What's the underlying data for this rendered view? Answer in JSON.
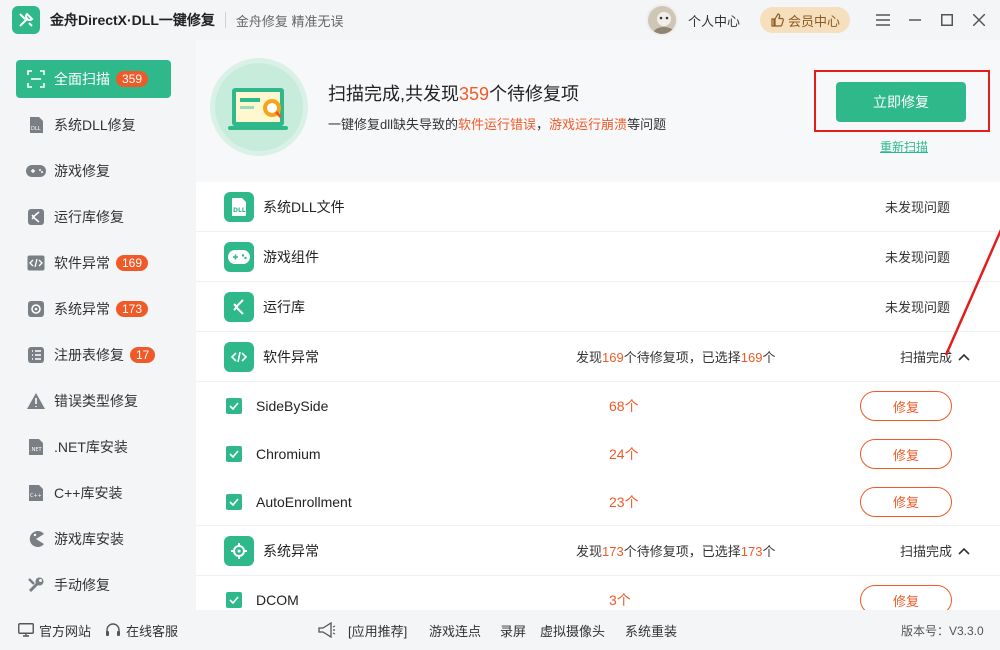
{
  "app": {
    "title": "金舟DirectX·DLL一键修复",
    "slogan": "金舟修复 精准无误",
    "user_center": "个人中心",
    "vip_label": "会员中心"
  },
  "sidebar": {
    "items": [
      {
        "label": "全面扫描",
        "badge": "359",
        "icon": "scan-icon",
        "active": true
      },
      {
        "label": "系统DLL修复",
        "badge": "",
        "icon": "dll-icon"
      },
      {
        "label": "游戏修复",
        "badge": "",
        "icon": "gamepad-icon"
      },
      {
        "label": "运行库修复",
        "badge": "",
        "icon": "vs-icon"
      },
      {
        "label": "软件异常",
        "badge": "169",
        "icon": "code-icon"
      },
      {
        "label": "系统异常",
        "badge": "173",
        "icon": "gear-icon"
      },
      {
        "label": "注册表修复",
        "badge": "17",
        "icon": "list-icon"
      },
      {
        "label": "错误类型修复",
        "badge": "",
        "icon": "warning-icon"
      },
      {
        "label": ".NET库安装",
        "badge": "",
        "icon": "net-icon"
      },
      {
        "label": "C++库安装",
        "badge": "",
        "icon": "cpp-icon"
      },
      {
        "label": "游戏库安装",
        "badge": "",
        "icon": "pacman-icon"
      },
      {
        "label": "手动修复",
        "badge": "",
        "icon": "wrench-icon"
      }
    ]
  },
  "hero": {
    "title_prefix": "扫描完成,共发现",
    "count": "359",
    "title_suffix": "个待修复项",
    "sub_prefix": "一键修复dll缺失导致的",
    "sub_hl1": "软件运行错误",
    "sub_sep": "，",
    "sub_hl2": "游戏运行崩溃",
    "sub_suffix": "等问题",
    "fix_now": "立即修复",
    "rescan": "重新扫描"
  },
  "categories": {
    "dll": {
      "name": "系统DLL文件",
      "status": "未发现问题"
    },
    "game": {
      "name": "游戏组件",
      "status": "未发现问题"
    },
    "runtime": {
      "name": "运行库",
      "status": "未发现问题"
    },
    "software": {
      "name": "软件异常",
      "found_prefix": "发现",
      "found": "169",
      "found_mid": "个待修复项，已选择",
      "selected": "169",
      "found_suffix": "个",
      "done": "扫描完成",
      "items": [
        {
          "name": "SideBySide",
          "count": "68个",
          "fix": "修复"
        },
        {
          "name": "Chromium",
          "count": "24个",
          "fix": "修复"
        },
        {
          "name": "AutoEnrollment",
          "count": "23个",
          "fix": "修复"
        }
      ]
    },
    "system": {
      "name": "系统异常",
      "found_prefix": "发现",
      "found": "173",
      "found_mid": "个待修复项，已选择",
      "selected": "173",
      "found_suffix": "个",
      "done": "扫描完成",
      "items": [
        {
          "name": "DCOM",
          "count": "3个",
          "fix": "修复"
        }
      ]
    }
  },
  "footer": {
    "official_site": "官方网站",
    "online_service": "在线客服",
    "recommend": "[应用推荐]",
    "links": [
      "游戏连点",
      "录屏",
      "虚拟摄像头",
      "系统重装"
    ],
    "version": "版本号：V3.3.0"
  },
  "colors": {
    "accent": "#2fb98a",
    "highlight": "#f05a28",
    "annotation": "#e51c1c"
  }
}
